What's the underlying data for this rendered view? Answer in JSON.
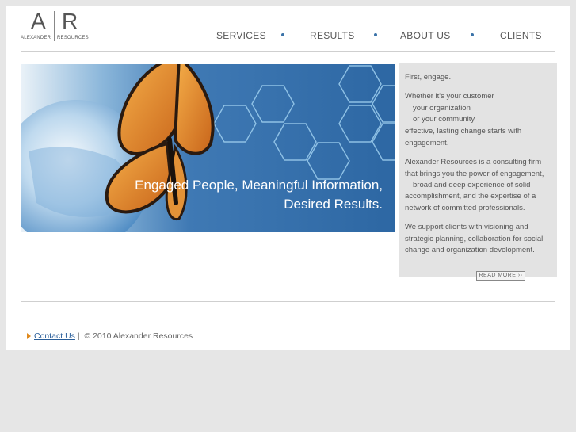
{
  "logo": {
    "left_letter": "A",
    "right_letter": "R",
    "left_word": "ALEXANDER",
    "right_word": "RESOURCES"
  },
  "nav": {
    "items": [
      "SERVICES",
      "RESULTS",
      "ABOUT US",
      "CLIENTS"
    ]
  },
  "banner": {
    "tagline_line1": "Engaged People, Meaningful Information,",
    "tagline_line2": "Desired Results."
  },
  "sidebar": {
    "heading": "First, engage.",
    "para1_line1": "Whether it's your customer",
    "para1_line2": "your organization",
    "para1_line3": "or your community",
    "para1_line4": "effective, lasting change starts with engagement.",
    "para2": "Alexander Resources is a consulting firm that brings you the power of engagement,",
    "para2_indent": "broad and deep experience of solid",
    "para2_tail": "accomplishment, and the expertise of a network of committed professionals.",
    "para3": "We support clients with visioning and strategic planning, collaboration for social change and organization development.",
    "read_more": "READ MORE ››"
  },
  "footer": {
    "contact_link": "Contact Us",
    "separator": "|",
    "copyright": "© 2010 Alexander Resources"
  },
  "colors": {
    "accent": "#3a72a8",
    "link": "#2b5f9a",
    "arrow": "#e08a1e",
    "page_bg": "#e6e6e6"
  }
}
